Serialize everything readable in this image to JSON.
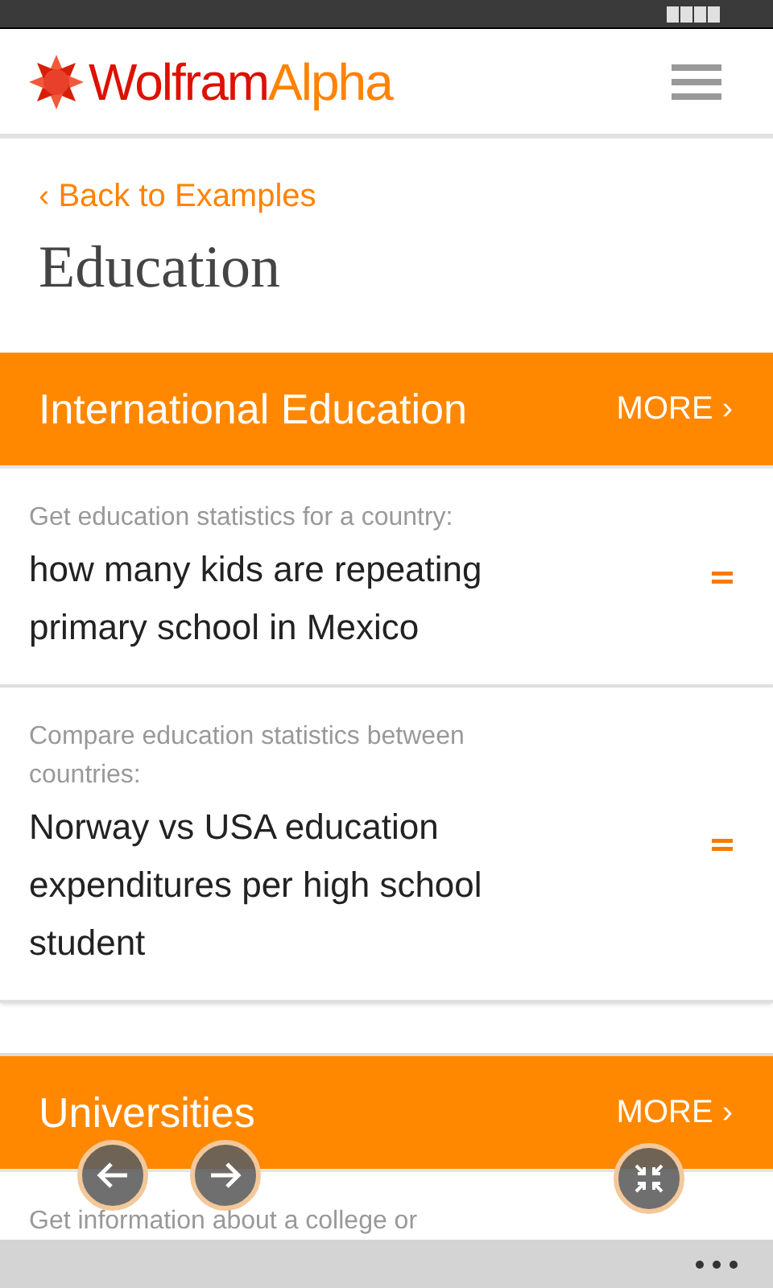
{
  "brand": {
    "first": "Wolfram",
    "second": "Alpha"
  },
  "back_link": "‹ Back to Examples",
  "page_title": "Education",
  "sections": [
    {
      "title": "International Education",
      "more": "MORE ›",
      "examples": [
        {
          "description": "Get education statistics for a country:",
          "query": "how many kids are repeating primary school in Mexico"
        },
        {
          "description": "Compare education statistics between countries:",
          "query": "Norway vs USA education expenditures per high school student"
        }
      ]
    },
    {
      "title": "Universities",
      "more": "MORE ›",
      "examples": [
        {
          "description": "Get information about a college or"
        }
      ]
    }
  ]
}
